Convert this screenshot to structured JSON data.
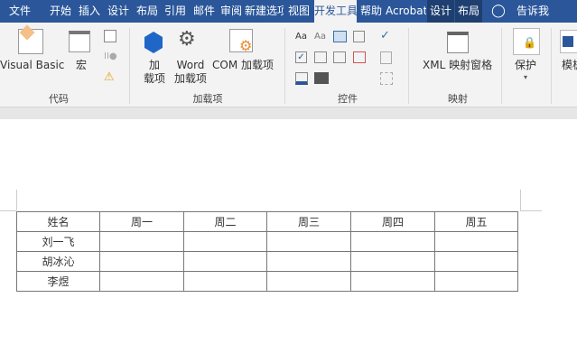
{
  "tabs": [
    {
      "label": "文件"
    },
    {
      "label": "开始"
    },
    {
      "label": "插入"
    },
    {
      "label": "设计"
    },
    {
      "label": "布局"
    },
    {
      "label": "引用"
    },
    {
      "label": "邮件"
    },
    {
      "label": "审阅"
    },
    {
      "label": "新建选项卡"
    },
    {
      "label": "视图"
    },
    {
      "label": "开发工具",
      "active": true
    },
    {
      "label": "帮助"
    },
    {
      "label": "Acrobat"
    },
    {
      "label": "设计"
    },
    {
      "label": "布局"
    }
  ],
  "tell_me": "告诉我",
  "ribbon": {
    "code": {
      "label": "代码",
      "visual_basic": "Visual Basic",
      "macro": "宏"
    },
    "addins": {
      "label": "加载项",
      "addins_line1": "加",
      "addins_line2": "载项",
      "word_line1": "Word",
      "word_line2": "加载项",
      "com": "COM 加载项"
    },
    "controls": {
      "label": "控件"
    },
    "mapping": {
      "label": "映射",
      "xml": "XML 映射窗格"
    },
    "protect": {
      "protect": "保护",
      "template": "模板"
    }
  },
  "table": {
    "headers": [
      "姓名",
      "周一",
      "周二",
      "周三",
      "周四",
      "周五"
    ],
    "rows": [
      [
        "刘一飞",
        "",
        "",
        "",
        "",
        ""
      ],
      [
        "胡冰沁",
        "",
        "",
        "",
        "",
        ""
      ],
      [
        "李煜",
        "",
        "",
        "",
        "",
        ""
      ]
    ]
  },
  "colors": {
    "tab_bar": "#2b579a",
    "ribbon": "#f3f3f3"
  }
}
